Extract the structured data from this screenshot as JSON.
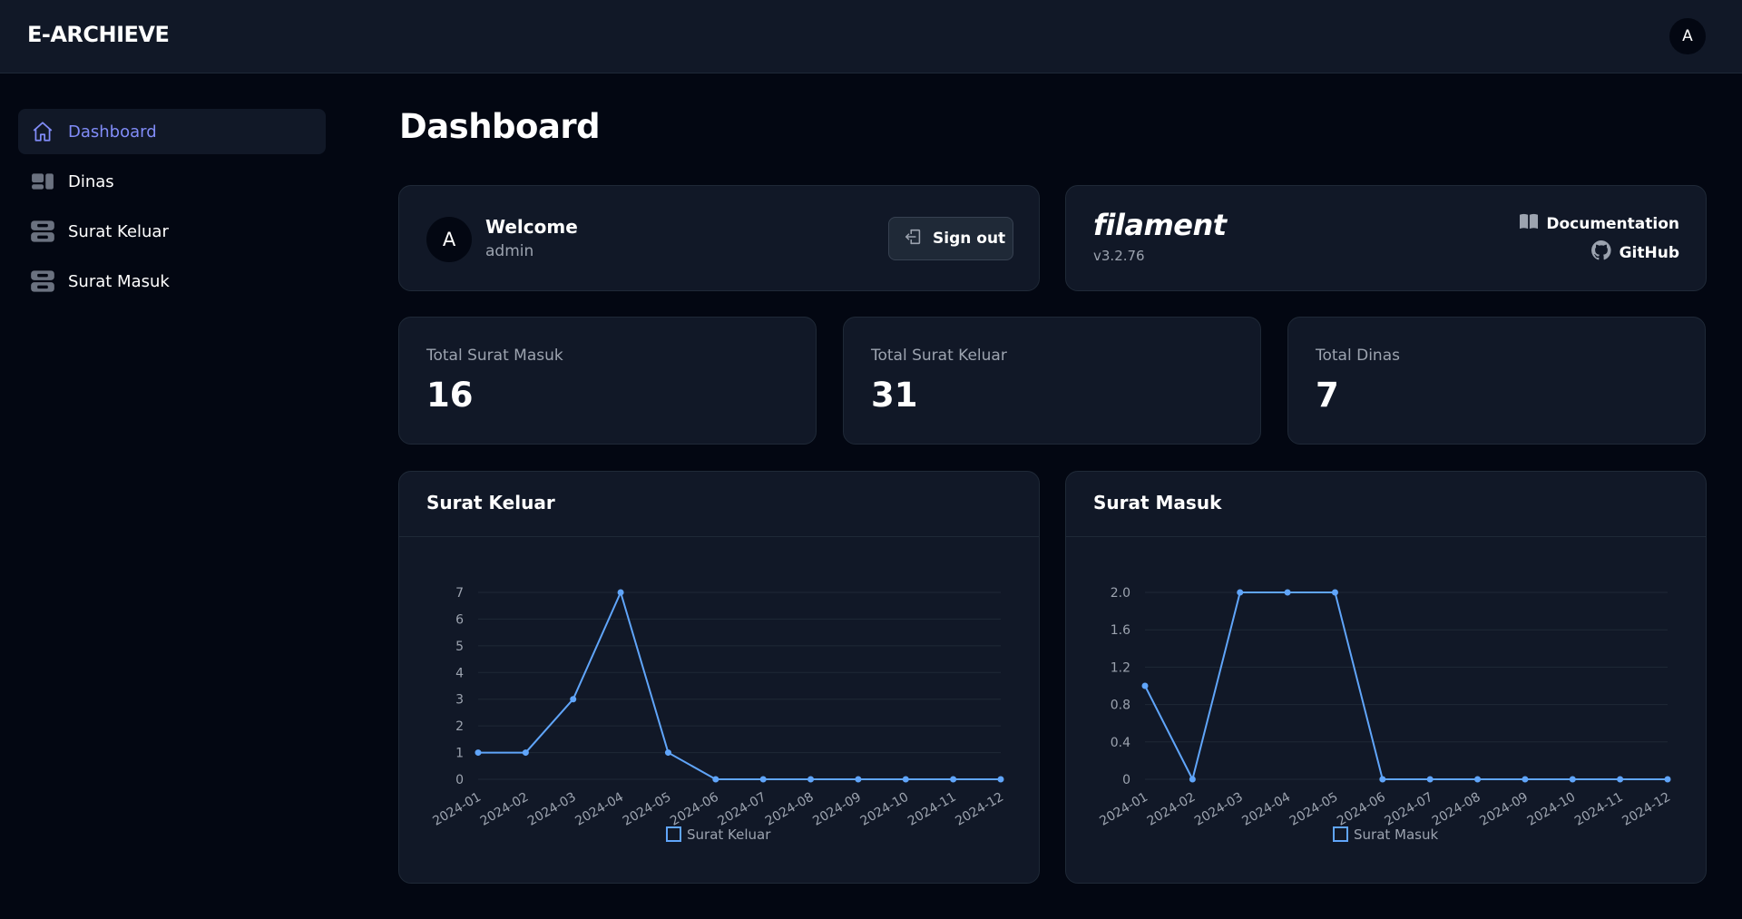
{
  "app": {
    "brand": "E-ARCHIEVE",
    "avatar_initial": "A"
  },
  "sidebar": {
    "items": [
      {
        "label": "Dashboard",
        "icon": "home-icon",
        "active": true
      },
      {
        "label": "Dinas",
        "icon": "dinas-icon",
        "active": false
      },
      {
        "label": "Surat Keluar",
        "icon": "inbox-stack-icon",
        "active": false
      },
      {
        "label": "Surat Masuk",
        "icon": "inbox-stack-icon",
        "active": false
      }
    ]
  },
  "page": {
    "title": "Dashboard"
  },
  "welcome": {
    "avatar_initial": "A",
    "title": "Welcome",
    "username": "admin",
    "signout_label": "Sign out"
  },
  "filament": {
    "logo": "filament",
    "version": "v3.2.76",
    "docs_label": "Documentation",
    "github_label": "GitHub"
  },
  "stats": [
    {
      "label": "Total Surat Masuk",
      "value": "16"
    },
    {
      "label": "Total Surat Keluar",
      "value": "31"
    },
    {
      "label": "Total Dinas",
      "value": "7"
    }
  ],
  "colors": {
    "accent": "#818cf8",
    "line": "#60a5fa",
    "background": "#030712",
    "card": "#111827"
  },
  "chart_data": [
    {
      "type": "line",
      "title": "Surat Keluar",
      "categories": [
        "2024-01",
        "2024-02",
        "2024-03",
        "2024-04",
        "2024-05",
        "2024-06",
        "2024-07",
        "2024-08",
        "2024-09",
        "2024-10",
        "2024-11",
        "2024-12"
      ],
      "series": [
        {
          "name": "Surat Keluar",
          "values": [
            1,
            1,
            3,
            7,
            1,
            0,
            0,
            0,
            0,
            0,
            0,
            0
          ]
        }
      ],
      "yticks": [
        "0",
        "1",
        "2",
        "3",
        "4",
        "5",
        "6",
        "7"
      ],
      "ylim": [
        0,
        7
      ],
      "grid": true,
      "legend": "bottom"
    },
    {
      "type": "line",
      "title": "Surat Masuk",
      "categories": [
        "2024-01",
        "2024-02",
        "2024-03",
        "2024-04",
        "2024-05",
        "2024-06",
        "2024-07",
        "2024-08",
        "2024-09",
        "2024-10",
        "2024-11",
        "2024-12"
      ],
      "series": [
        {
          "name": "Surat Masuk",
          "values": [
            1,
            0,
            2,
            2,
            2,
            0,
            0,
            0,
            0,
            0,
            0,
            0
          ]
        }
      ],
      "yticks": [
        "0",
        "0.4",
        "0.8",
        "1.2",
        "1.6",
        "2.0"
      ],
      "ylim": [
        0,
        2
      ],
      "grid": true,
      "legend": "bottom"
    }
  ]
}
